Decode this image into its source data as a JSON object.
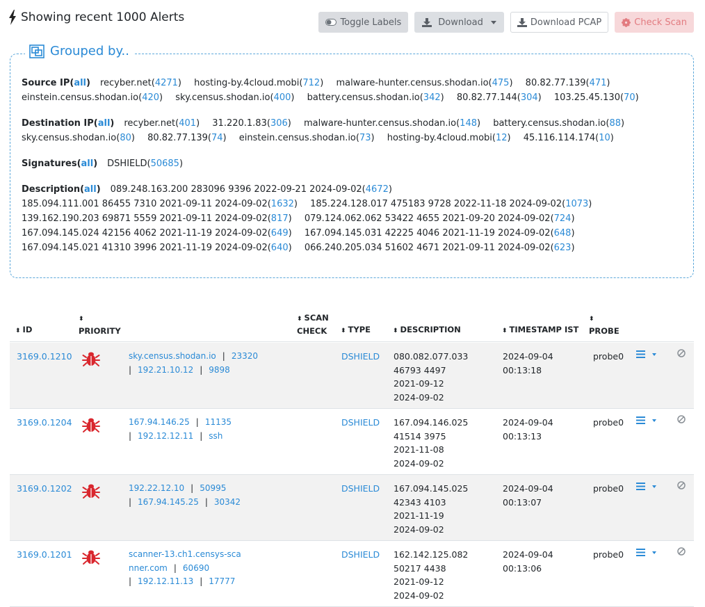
{
  "header": {
    "title": "Showing recent 1000 Alerts",
    "buttons": {
      "toggle_labels": "Toggle Labels",
      "download": "Download",
      "download_pcap": "Download PCAP",
      "check_scan": "Check Scan"
    }
  },
  "grouped": {
    "title": "Grouped by..",
    "source": {
      "label": "Source IP(",
      "all": "all",
      "items": [
        {
          "name": "recyber.net",
          "count": "4271"
        },
        {
          "name": "hosting-by.4cloud.mobi",
          "count": "712"
        },
        {
          "name": "malware-hunter.census.shodan.io",
          "count": "475"
        },
        {
          "name": "80.82.77.139",
          "count": "471"
        },
        {
          "name": "einstein.census.shodan.io",
          "count": "420"
        },
        {
          "name": "sky.census.shodan.io",
          "count": "400"
        },
        {
          "name": "battery.census.shodan.io",
          "count": "342"
        },
        {
          "name": "80.82.77.144",
          "count": "304"
        },
        {
          "name": "103.25.45.130",
          "count": "70"
        }
      ]
    },
    "destination": {
      "label": "Destination IP(",
      "all": "all",
      "items": [
        {
          "name": "recyber.net",
          "count": "401"
        },
        {
          "name": "31.220.1.83",
          "count": "306"
        },
        {
          "name": "malware-hunter.census.shodan.io",
          "count": "148"
        },
        {
          "name": "battery.census.shodan.io",
          "count": "88"
        },
        {
          "name": "sky.census.shodan.io",
          "count": "80"
        },
        {
          "name": "80.82.77.139",
          "count": "74"
        },
        {
          "name": "einstein.census.shodan.io",
          "count": "73"
        },
        {
          "name": "hosting-by.4cloud.mobi",
          "count": "12"
        },
        {
          "name": "45.116.114.174",
          "count": "10"
        }
      ]
    },
    "signatures": {
      "label": "Signatures(",
      "all": "all",
      "items": [
        {
          "name": "DSHIELD",
          "count": "50685"
        }
      ]
    },
    "description": {
      "label": "Description(",
      "all": "all",
      "items": [
        {
          "name": "089.248.163.200 283096 9396 2022-09-21 2024-09-02",
          "count": "4672"
        },
        {
          "name": "185.094.111.001 86455 7310 2021-09-11 2024-09-02",
          "count": "1632"
        },
        {
          "name": "185.224.128.017 475183 9728 2022-11-18 2024-09-02",
          "count": "1073"
        },
        {
          "name": "139.162.190.203 69871 5559 2021-09-11 2024-09-02",
          "count": "817"
        },
        {
          "name": "079.124.062.062 53422 4655 2021-09-20 2024-09-02",
          "count": "724"
        },
        {
          "name": "167.094.145.024 42156 4062 2021-11-19 2024-09-02",
          "count": "649"
        },
        {
          "name": "167.094.145.031 42225 4046 2021-11-19 2024-09-02",
          "count": "648"
        },
        {
          "name": "167.094.145.021 41310 3996 2021-11-19 2024-09-02",
          "count": "640"
        },
        {
          "name": "066.240.205.034 51602 4671 2021-09-11 2024-09-02",
          "count": "623"
        }
      ]
    }
  },
  "table": {
    "columns": {
      "id": "ID",
      "priority": "PRIORITY",
      "scan_check_1": "SCAN",
      "scan_check_2": "CHECK",
      "type": "TYPE",
      "description": "DESCRIPTION",
      "timestamp": "TIMESTAMP IST",
      "probe": "PROBE"
    },
    "rows": [
      {
        "id": "3169.0.1210",
        "src": "sky.census.shodan.io",
        "src_port": "23320",
        "dst": "192.21.10.12",
        "dst_port": "9898",
        "type": "DSHIELD",
        "desc": [
          "080.082.077.033",
          "46793 4497",
          "2021-09-12",
          "2024-09-02"
        ],
        "ts": [
          "2024-09-04",
          "00:13:18"
        ],
        "probe": "probe0"
      },
      {
        "id": "3169.0.1204",
        "src": "167.94.146.25",
        "src_port": "11135",
        "dst": "192.12.12.11",
        "dst_port": "ssh",
        "type": "DSHIELD",
        "desc": [
          "167.094.146.025",
          "41514 3975",
          "2021-11-08",
          "2024-09-02"
        ],
        "ts": [
          "2024-09-04",
          "00:13:13"
        ],
        "probe": "probe0"
      },
      {
        "id": "3169.0.1202",
        "src": "192.22.12.10",
        "src_port": "50995",
        "dst": "167.94.145.25",
        "dst_port": "30342",
        "type": "DSHIELD",
        "desc": [
          "167.094.145.025",
          "42343 4103",
          "2021-11-19",
          "2024-09-02"
        ],
        "ts": [
          "2024-09-04",
          "00:13:07"
        ],
        "probe": "probe0"
      },
      {
        "id": "3169.0.1201",
        "src": "scanner-13.ch1.censys-sca nner.com",
        "src_port": "60690",
        "dst": "192.12.11.13",
        "dst_port": "17777",
        "type": "DSHIELD",
        "desc": [
          "162.142.125.082",
          "50217 4438",
          "2021-09-12",
          "2024-09-02"
        ],
        "ts": [
          "2024-09-04",
          "00:13:06"
        ],
        "probe": "probe0"
      }
    ]
  }
}
